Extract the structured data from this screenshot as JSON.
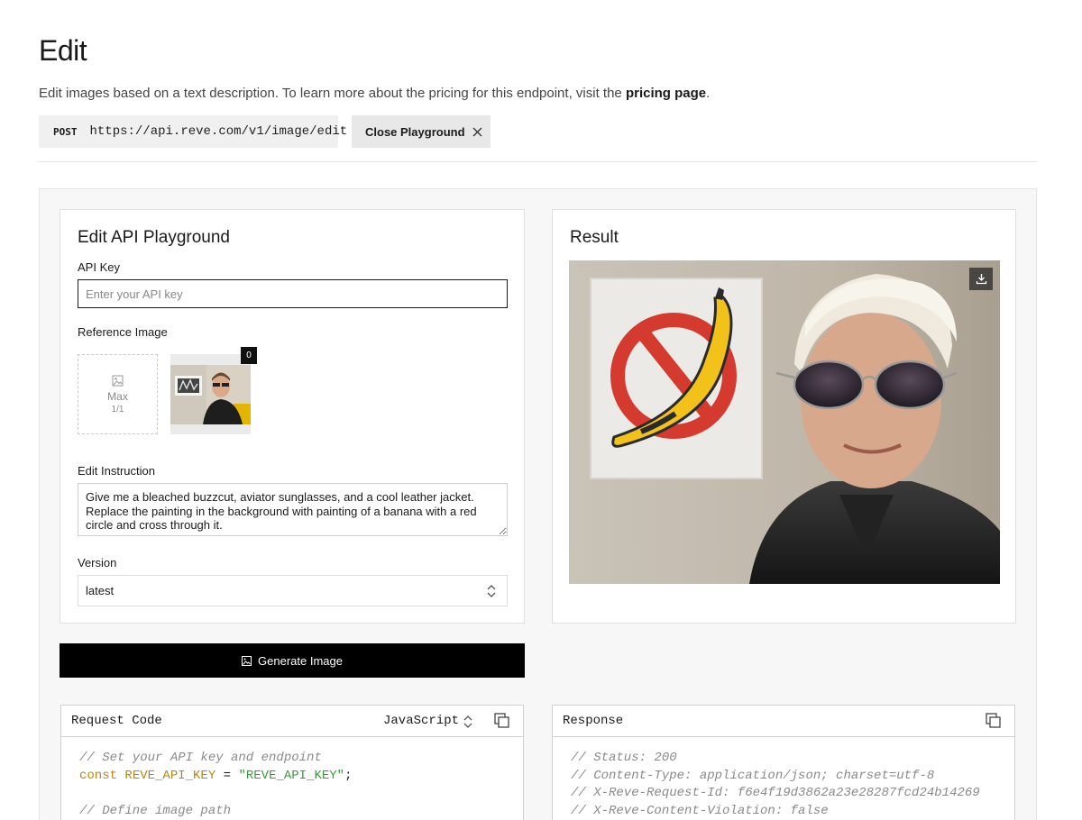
{
  "page": {
    "title": "Edit",
    "description_prefix": "Edit images based on a text description. To learn more about the pricing for this endpoint, visit the ",
    "pricing_link": "pricing page",
    "description_suffix": "."
  },
  "endpoint": {
    "method": "POST",
    "url": "https://api.reve.com/v1/image/edit"
  },
  "close_button": {
    "label": "Close Playground",
    "icon": "close-icon"
  },
  "playground": {
    "title": "Edit API Playground",
    "api_key": {
      "label": "API Key",
      "placeholder": "Enter your API key",
      "value": ""
    },
    "reference_image": {
      "label": "Reference Image",
      "upload_max": "Max",
      "upload_ratio": "1/1",
      "badge": "0"
    },
    "instruction": {
      "label": "Edit Instruction",
      "value": "Give me a bleached buzzcut, aviator sunglasses, and a cool leather jacket. Replace the painting in the background with painting of a banana with a red circle and cross through it."
    },
    "version": {
      "label": "Version",
      "selected": "latest"
    }
  },
  "result": {
    "title": "Result",
    "download_icon": "download-icon"
  },
  "generate_button": {
    "label": "Generate Image",
    "icon": "image-icon"
  },
  "request_code": {
    "title": "Request Code",
    "language": "JavaScript",
    "lines": [
      {
        "comment": "// Set your API key and endpoint"
      },
      {
        "kw": "const",
        "var": "REVE_API_KEY",
        "op": " = ",
        "str": "\"REVE_API_KEY\"",
        "end": ";"
      },
      {
        "blank": ""
      },
      {
        "comment": "// Define image path"
      }
    ]
  },
  "response": {
    "title": "Response",
    "lines": [
      "// Status: 200",
      "// Content-Type: application/json; charset=utf-8",
      "// X-Reve-Request-Id: f6e4f19d3862a23e28287fcd24b14269",
      "// X-Reve-Content-Violation: false"
    ]
  },
  "colors": {
    "accent": "#000000",
    "panel_bg": "#f7f7f7",
    "code_keyword": "#b8860b",
    "code_string": "#3a9a3a",
    "code_comment": "#8a8a8a"
  }
}
